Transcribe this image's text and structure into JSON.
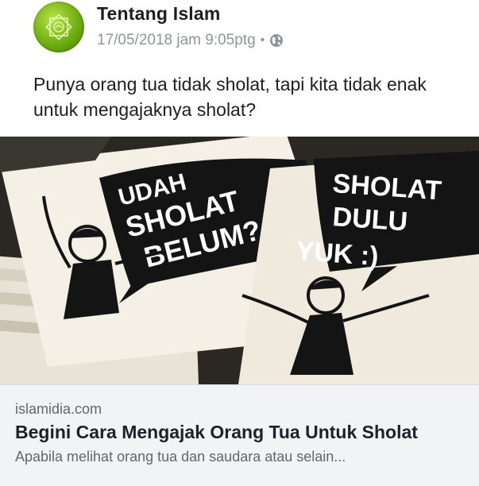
{
  "post": {
    "page_name": "Tentang Islam",
    "timestamp": "17/05/2018 jam 9:05ptg",
    "separator": "•",
    "privacy_icon": "globe-icon",
    "text": "Punya orang tua tidak sholat, tapi kita tidak enak untuk mengajaknya sholat?"
  },
  "image": {
    "sign_left_text": [
      "UDAH",
      "SHOLAT",
      "BELUM?"
    ],
    "sign_right_text": [
      "SHOLAT",
      "DULU",
      "YUK :)"
    ]
  },
  "link_preview": {
    "domain": "islamidia.com",
    "title": "Begini Cara Mengajak Orang Tua Untuk Sholat",
    "description": "Apabila melihat orang tua dan saudara atau selain..."
  },
  "colors": {
    "avatar_green": "#6fae12",
    "meta_gray": "#90949c",
    "preview_bg": "#f2f3f5"
  }
}
